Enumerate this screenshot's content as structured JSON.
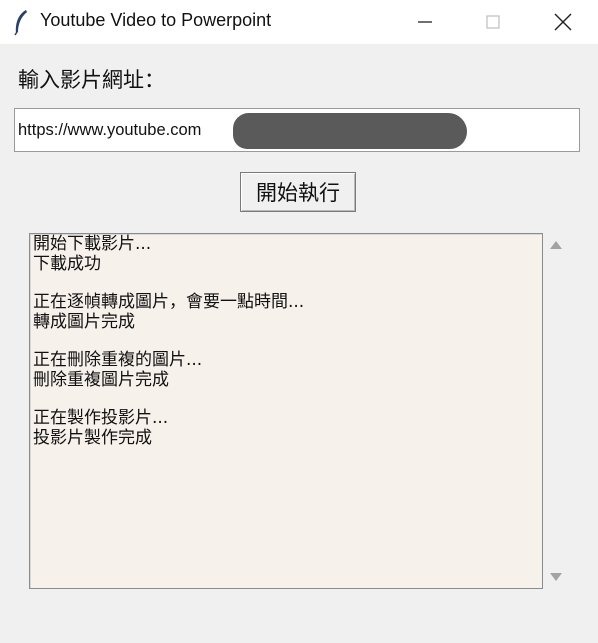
{
  "window": {
    "title": "Youtube Video to Powerpoint",
    "icon": "feather-icon"
  },
  "form": {
    "prompt_label": "輸入影片網址：",
    "url_value": "https://www.youtube.com"
  },
  "actions": {
    "run_label": "開始執行"
  },
  "log": {
    "lines": [
      "開始下載影片...",
      "下載成功",
      "",
      "正在逐幀轉成圖片，會要一點時間...",
      "轉成圖片完成",
      "",
      "正在刪除重複的圖片...",
      "刪除重複圖片完成",
      "",
      "正在製作投影片...",
      "投影片製作完成"
    ]
  },
  "colors": {
    "window_bg": "#f0f0f0",
    "log_bg": "#f6f1eb",
    "redaction": "#5a5a5a"
  }
}
